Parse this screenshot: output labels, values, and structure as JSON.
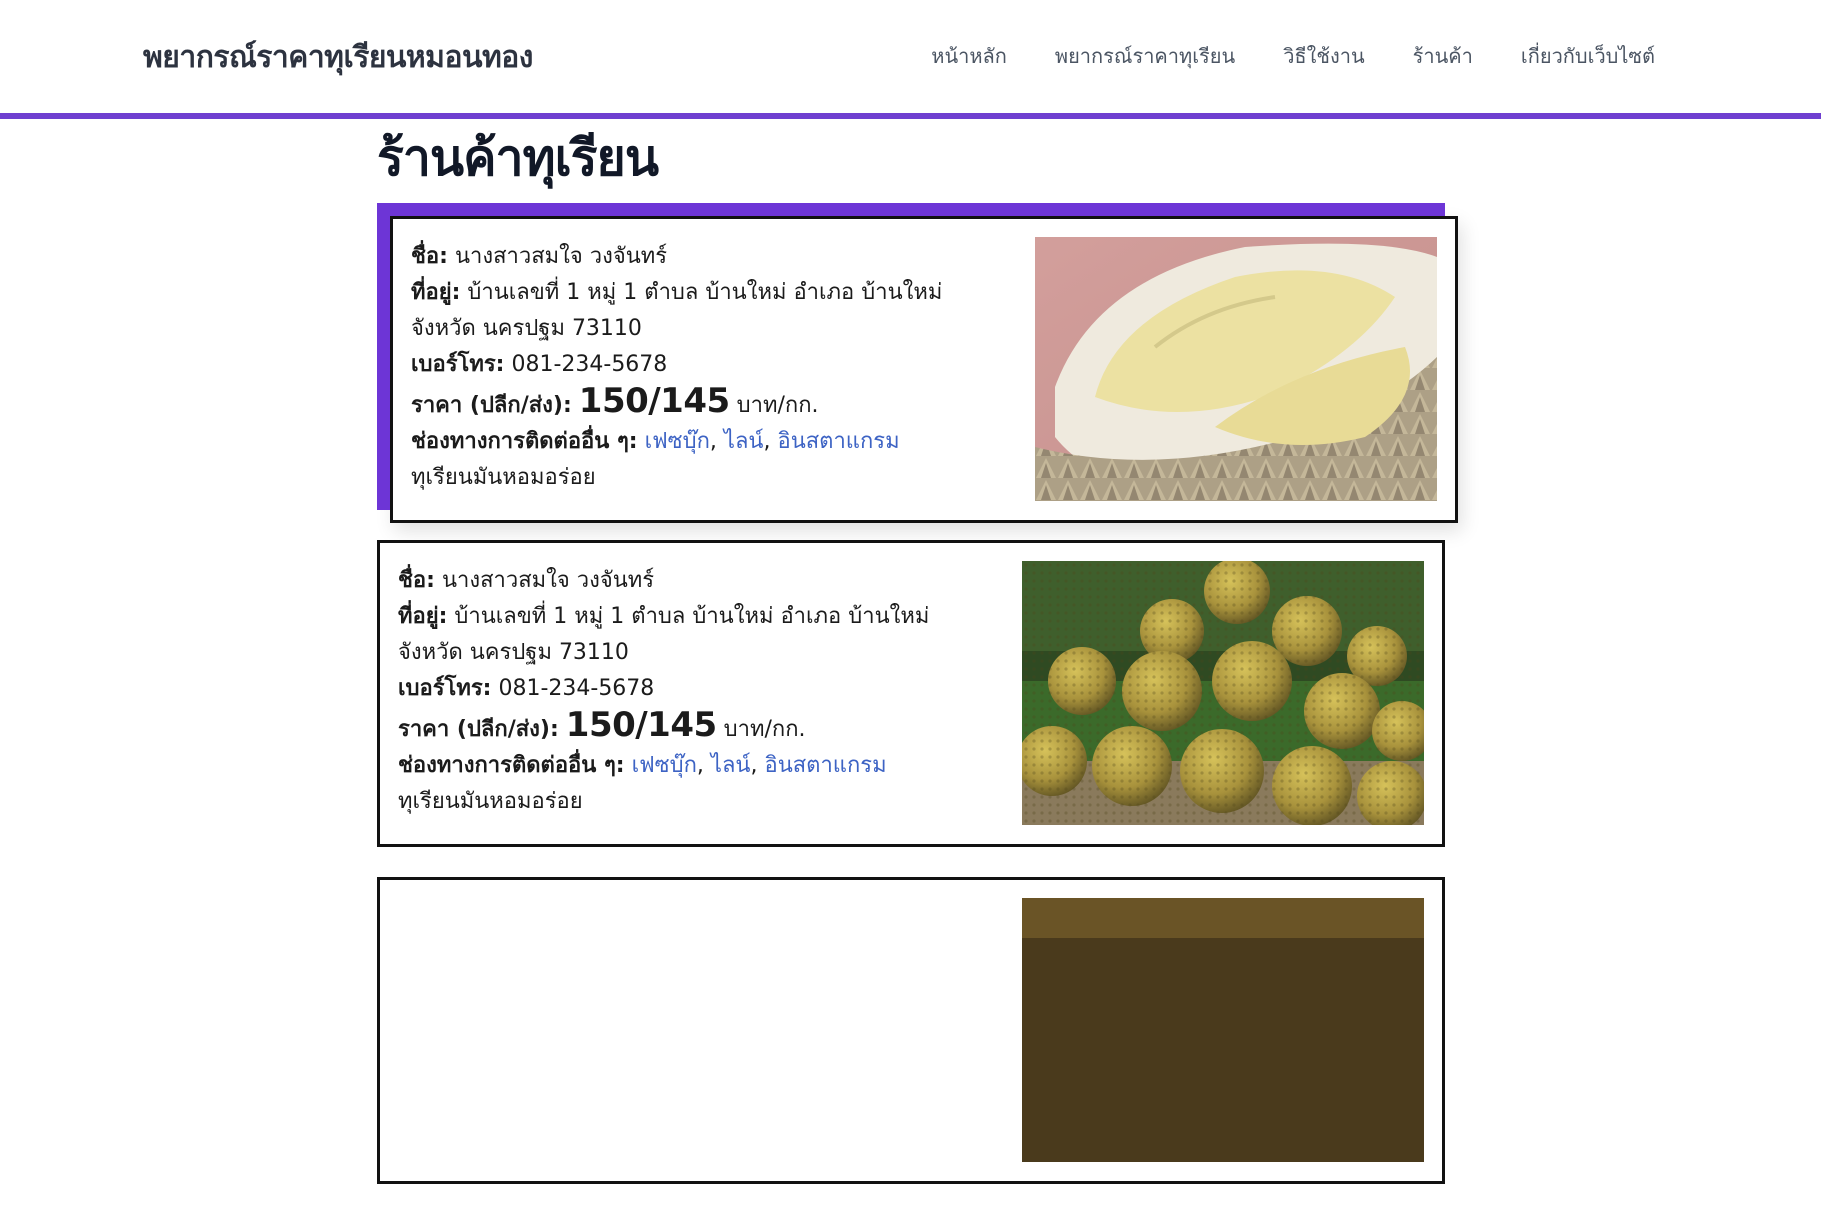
{
  "site": {
    "brand": "พยากรณ์ราคาทุเรียนหมอนทอง",
    "accent": "#6f3fd0",
    "nav": [
      "หน้าหลัก",
      "พยากรณ์ราคาทุเรียน",
      "วิธีใช้งาน",
      "ร้านค้า",
      "เกี่ยวกับเว็บไซต์"
    ]
  },
  "page": {
    "title": "ร้านค้าทุเรียน"
  },
  "labels": {
    "name": "ชื่อ:",
    "address": "ที่อยู่:",
    "phone": "เบอร์โทร:",
    "price": "ราคา (ปลีก/ส่ง):",
    "channels": "ช่องทางการติดต่ออื่น ๆ:",
    "separator": ","
  },
  "shops": [
    {
      "name": "นางสาวสมใจ วงจันทร์",
      "address": "บ้านเลขที่ 1 หมู่ 1 ตำบล บ้านใหม่ อำเภอ บ้านใหม่ จังหวัด นครปฐม 73110",
      "phone": "081-234-5678",
      "price": "150/145",
      "unit": "บาท/กก.",
      "channels": [
        "เฟซบุ๊ก",
        "ไลน์",
        "อินสตาแกรม"
      ],
      "description": "ทุเรียนมันหอมอร่อย",
      "image": "durian-flesh-photo"
    },
    {
      "name": "นางสาวสมใจ วงจันทร์",
      "address": "บ้านเลขที่ 1 หมู่ 1 ตำบล บ้านใหม่ อำเภอ บ้านใหม่ จังหวัด นครปฐม 73110",
      "phone": "081-234-5678",
      "price": "150/145",
      "unit": "บาท/กก.",
      "channels": [
        "เฟซบุ๊ก",
        "ไลน์",
        "อินสตาแกรม"
      ],
      "description": "ทุเรียนมันหอมอร่อย",
      "image": "durian-pile-photo"
    }
  ]
}
